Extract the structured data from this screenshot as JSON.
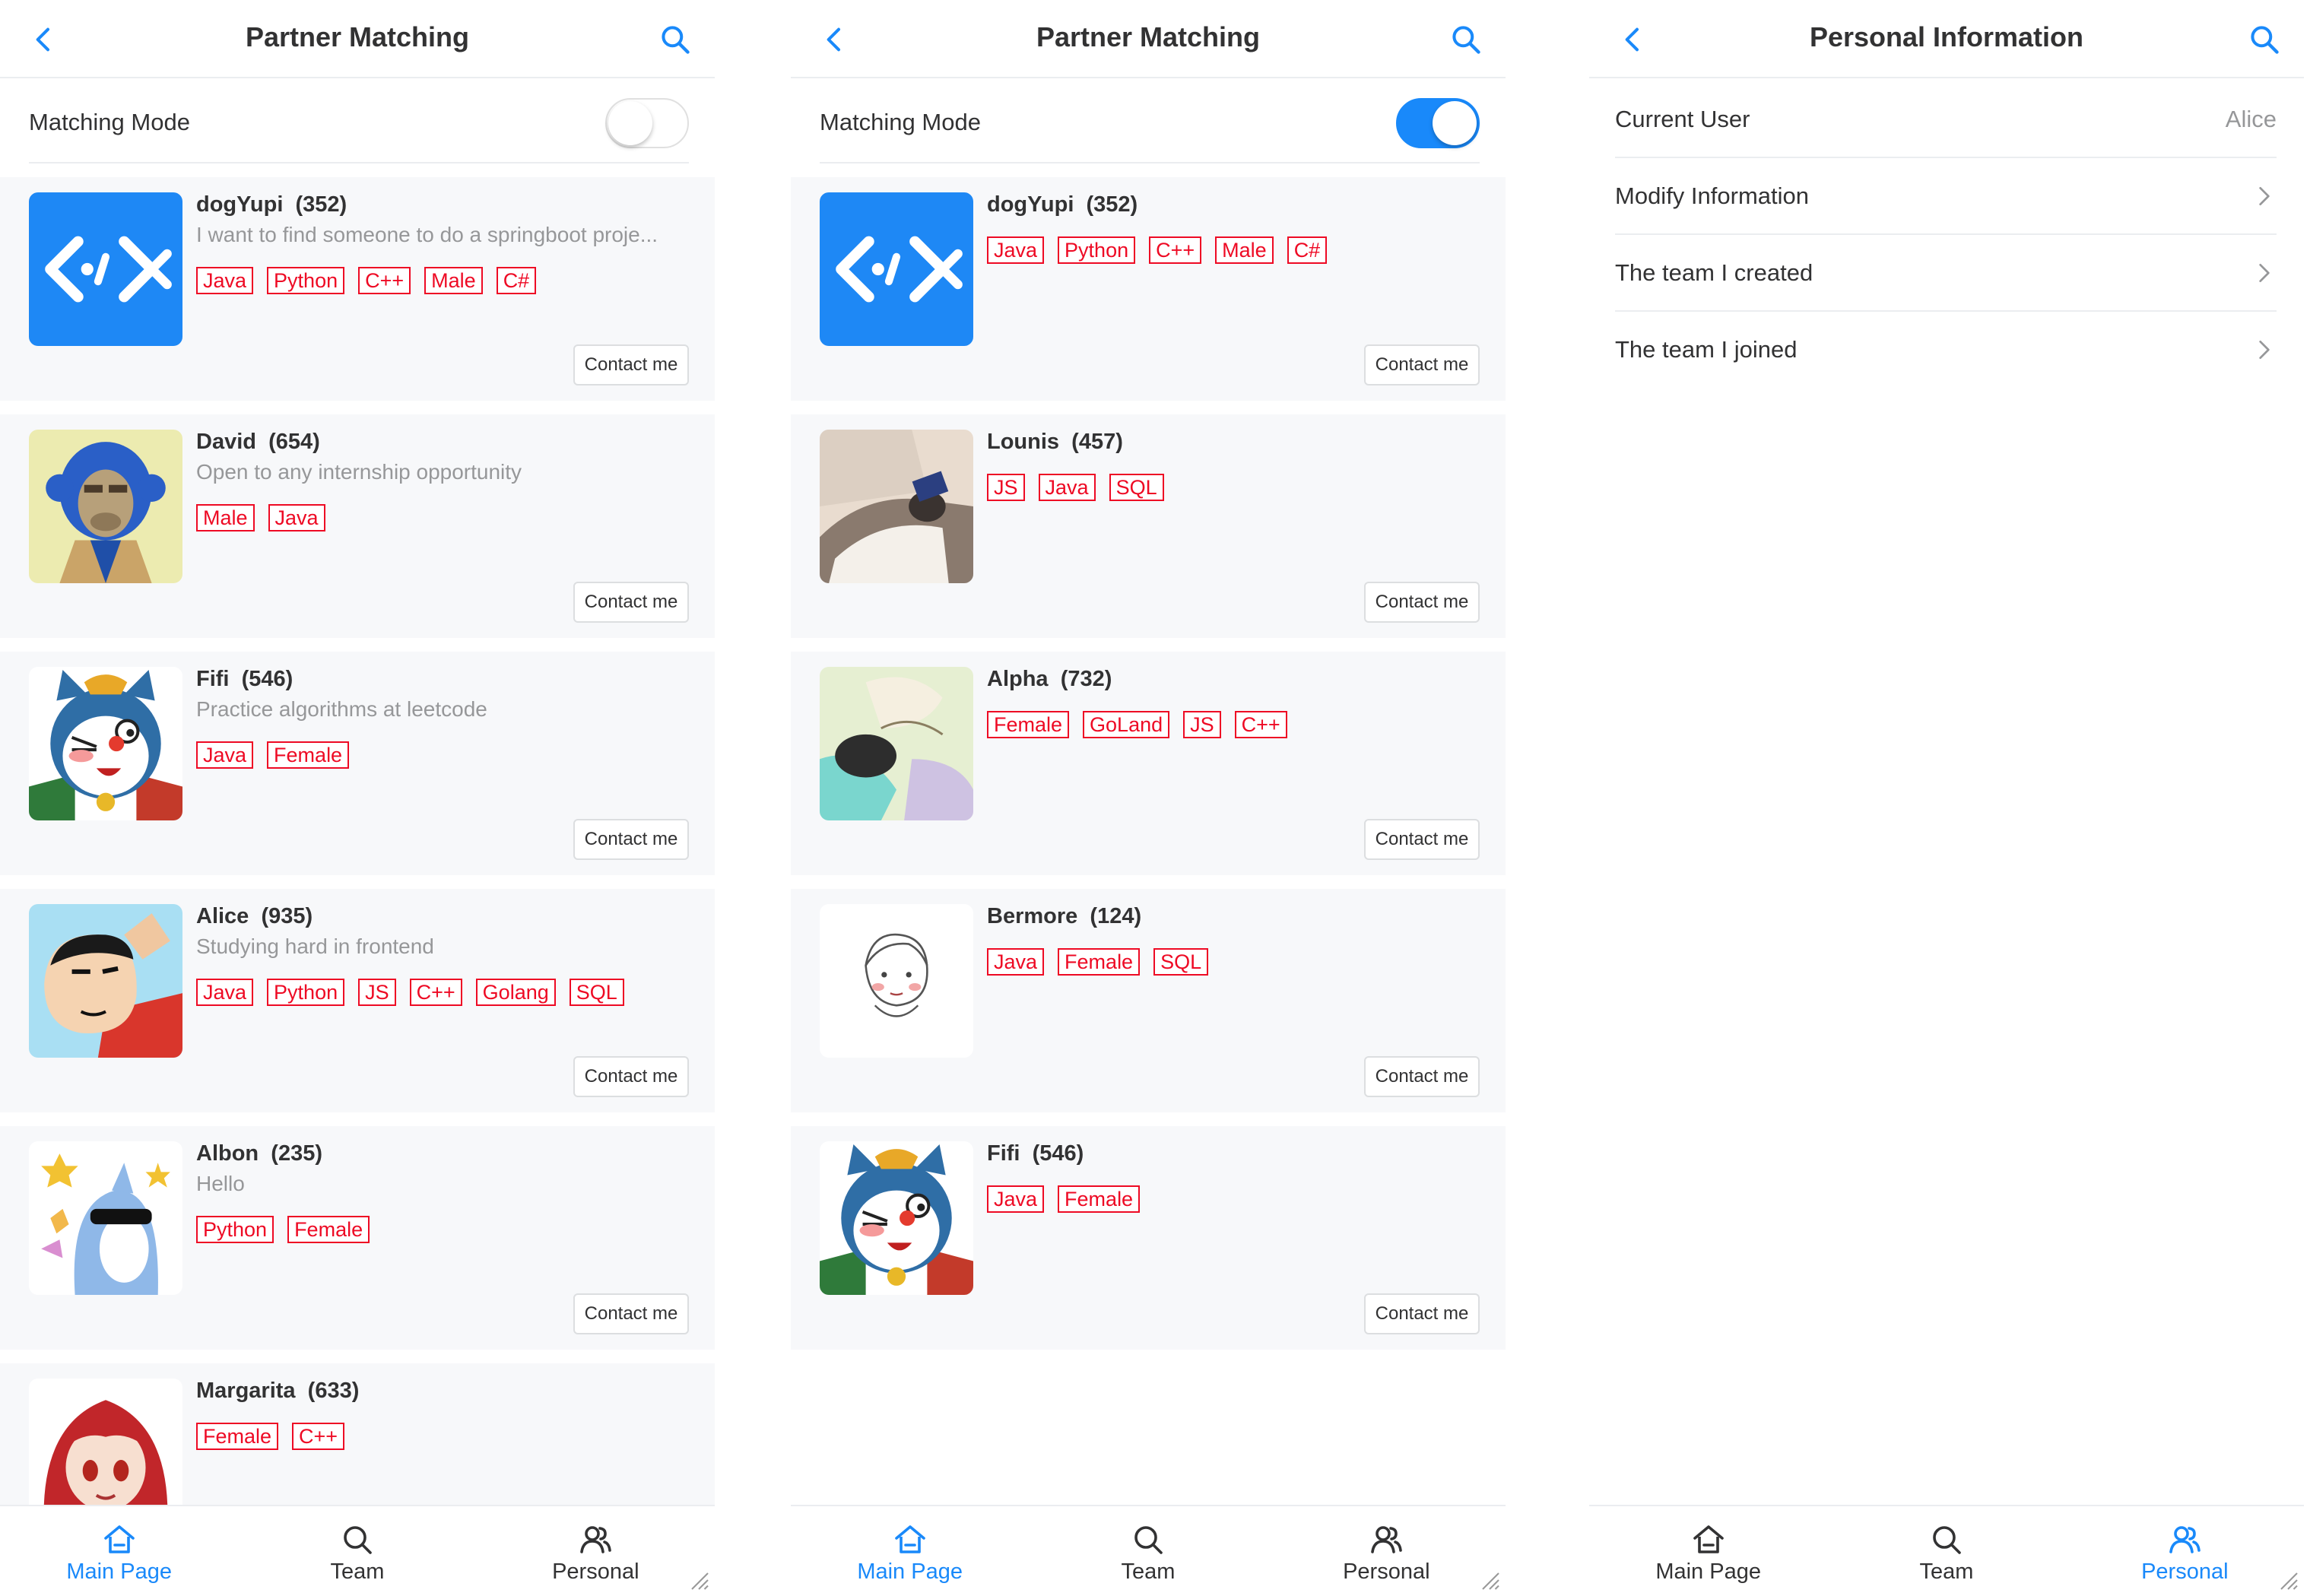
{
  "colors": {
    "accent": "#1989fa",
    "tag": "#ee0a24",
    "muted": "#969799",
    "card_bg": "#f7f8fa"
  },
  "screen1": {
    "title": "Partner Matching",
    "matching_mode": {
      "label": "Matching Mode",
      "on": false
    },
    "users": [
      {
        "name": "dogYupi",
        "id": "(352)",
        "desc": "I want to find someone to do a springboot proje...",
        "tags": [
          "Java",
          "Python",
          "C++",
          "Male",
          "C#"
        ],
        "avatar": "code-logo-avatar"
      },
      {
        "name": "David",
        "id": "(654)",
        "desc": "Open to any internship opportunity",
        "tags": [
          "Male",
          "Java"
        ],
        "avatar": "ape-avatar"
      },
      {
        "name": "Fifi",
        "id": "(546)",
        "desc": "Practice algorithms at leetcode",
        "tags": [
          "Java",
          "Female"
        ],
        "avatar": "cat-robot-avatar"
      },
      {
        "name": "Alice",
        "id": "(935)",
        "desc": "Studying hard in frontend",
        "tags": [
          "Java",
          "Python",
          "JS",
          "C++",
          "Golang",
          "SQL"
        ],
        "avatar": "cartoon-boy-avatar"
      },
      {
        "name": "Albon",
        "id": "(235)",
        "desc": "Hello",
        "tags": [
          "Python",
          "Female"
        ],
        "avatar": "shark-avatar"
      },
      {
        "name": "Margarita",
        "id": "(633)",
        "desc": "",
        "tags": [
          "Female",
          "C++"
        ],
        "avatar": "anime-girl-avatar"
      }
    ],
    "contact_label": "Contact me",
    "tabs": [
      {
        "label": "Main Page",
        "icon": "home-icon",
        "active": true
      },
      {
        "label": "Team",
        "icon": "search-icon",
        "active": false
      },
      {
        "label": "Personal",
        "icon": "friends-icon",
        "active": false
      }
    ]
  },
  "screen2": {
    "title": "Partner Matching",
    "matching_mode": {
      "label": "Matching Mode",
      "on": true
    },
    "users": [
      {
        "name": "dogYupi",
        "id": "(352)",
        "tags": [
          "Java",
          "Python",
          "C++",
          "Male",
          "C#"
        ],
        "avatar": "code-logo-avatar"
      },
      {
        "name": "Lounis",
        "id": "(457)",
        "tags": [
          "JS",
          "Java",
          "SQL"
        ],
        "avatar": "sleeping-person-avatar"
      },
      {
        "name": "Alpha",
        "id": "(732)",
        "tags": [
          "Female",
          "GoLand",
          "JS",
          "C++"
        ],
        "avatar": "watercolor-avatar"
      },
      {
        "name": "Bermore",
        "id": "(124)",
        "tags": [
          "Java",
          "Female",
          "SQL"
        ],
        "avatar": "sketch-girl-avatar"
      },
      {
        "name": "Fifi",
        "id": "(546)",
        "tags": [
          "Java",
          "Female"
        ],
        "avatar": "cat-robot-avatar"
      }
    ],
    "contact_label": "Contact me",
    "tabs": [
      {
        "label": "Main Page",
        "icon": "home-icon",
        "active": true
      },
      {
        "label": "Team",
        "icon": "search-icon",
        "active": false
      },
      {
        "label": "Personal",
        "icon": "friends-icon",
        "active": false
      }
    ]
  },
  "screen3": {
    "title": "Personal Information",
    "cells": [
      {
        "label": "Current User",
        "value": "Alice"
      },
      {
        "label": "Modify Information",
        "value": ""
      },
      {
        "label": "The team I created",
        "value": ""
      },
      {
        "label": "The team I joined",
        "value": ""
      }
    ],
    "tabs": [
      {
        "label": "Main Page",
        "icon": "home-icon",
        "active": false
      },
      {
        "label": "Team",
        "icon": "search-icon",
        "active": false
      },
      {
        "label": "Personal",
        "icon": "friends-icon",
        "active": true
      }
    ]
  }
}
